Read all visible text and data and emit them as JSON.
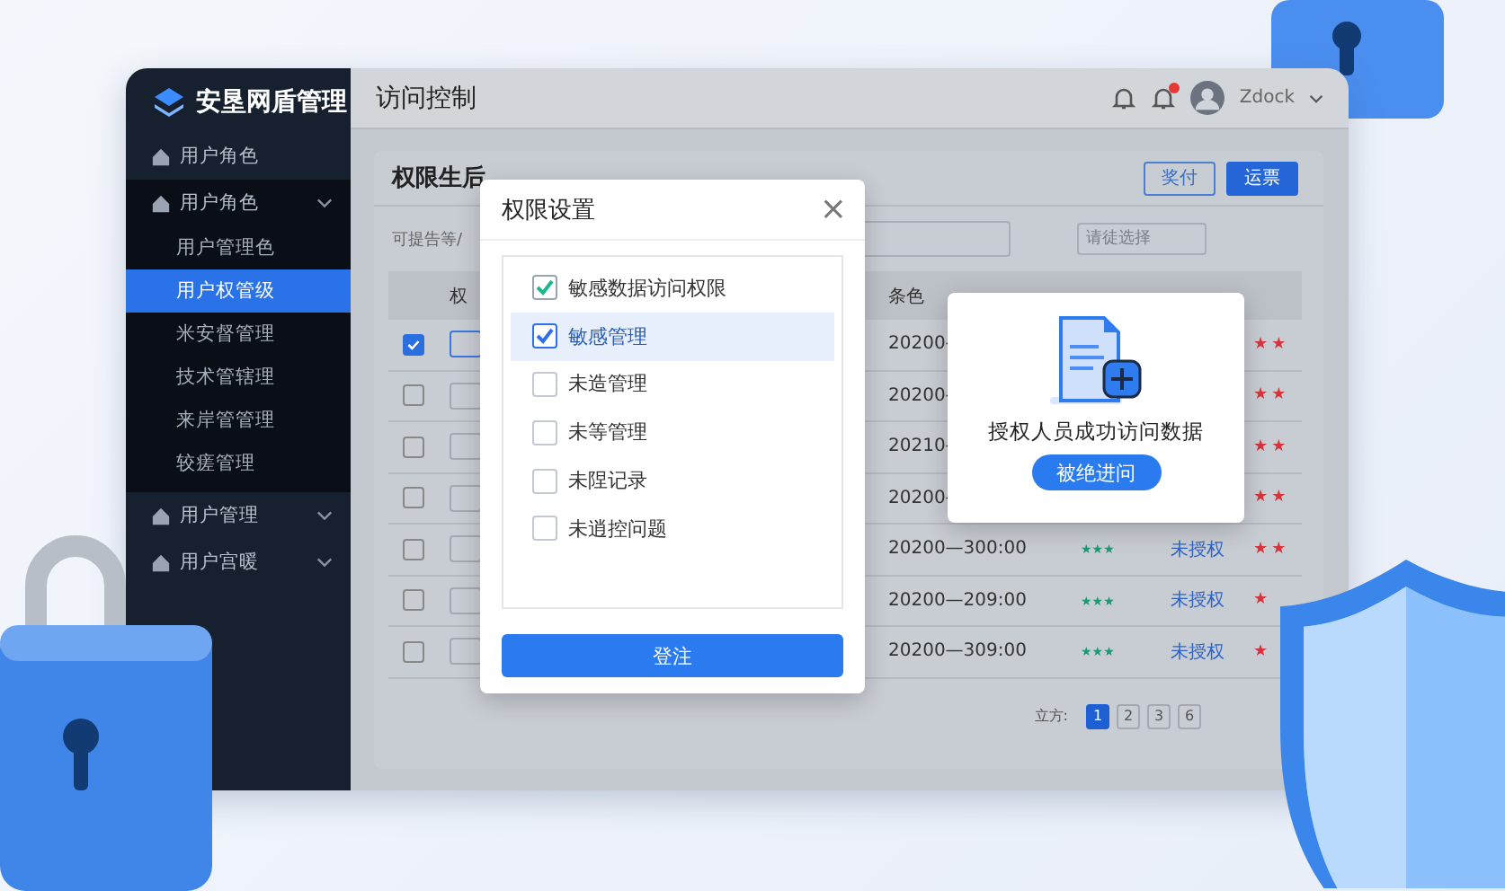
{
  "app": {
    "logo": "安垦网盾管理"
  },
  "sidebar": {
    "items": [
      {
        "label": "用户角色",
        "expanded": false,
        "has_chevron": false
      },
      {
        "label": "用户角色",
        "expanded": true,
        "has_chevron": true,
        "children": [
          {
            "label": "用户管理色",
            "selected": false
          },
          {
            "label": "用户权管级",
            "selected": true
          },
          {
            "label": "米安督管理",
            "selected": false
          },
          {
            "label": "技术管辖理",
            "selected": false
          },
          {
            "label": "来岸管管理",
            "selected": false
          },
          {
            "label": "较瘥管理",
            "selected": false
          }
        ]
      },
      {
        "label": "用户管理",
        "expanded": false,
        "has_chevron": true
      },
      {
        "label": "用户宫暖",
        "expanded": false,
        "has_chevron": true
      }
    ]
  },
  "header": {
    "title": "访问控制",
    "user": "Zdock",
    "notification_badge": true
  },
  "card": {
    "title": "权限生后",
    "buttons": [
      {
        "label": "奖付",
        "kind": "outline"
      },
      {
        "label": "运票",
        "kind": "primary"
      }
    ],
    "filter_label": "可提告等/",
    "filter_placeholder": "请徒选择",
    "columns": [
      "权",
      "条色"
    ],
    "rows": [
      {
        "checked": true,
        "time": "20200-",
        "priority": "★★"
      },
      {
        "checked": false,
        "time": "20200-",
        "priority": "★★"
      },
      {
        "checked": false,
        "time": "20210-",
        "priority": "★★"
      },
      {
        "checked": false,
        "time": "20200-",
        "priority": "★★"
      },
      {
        "checked": false,
        "time": "20200—300:00",
        "rating": {
          "stars": 3
        },
        "note": "未授权",
        "priority": "★★"
      },
      {
        "checked": false,
        "time": "20200—209:00",
        "rating": {
          "stars": 3
        },
        "note": "未授权",
        "priority": "★"
      },
      {
        "checked": false,
        "time": "20200—309:00",
        "rating": {
          "stars": 3
        },
        "note": "未授权",
        "priority": "★"
      }
    ],
    "pagination": {
      "label": "立方:",
      "pages": [
        {
          "label": "1",
          "selected": true
        },
        {
          "label": "2",
          "selected": false
        },
        {
          "label": "3",
          "selected": false
        },
        {
          "label": "6",
          "selected": false
        }
      ]
    }
  },
  "dialog": {
    "title": "权限设置",
    "close": "×",
    "options": [
      {
        "label": "敏感数据访问权限",
        "checked": true,
        "selected": false
      },
      {
        "label": "敏感管理",
        "checked": true,
        "selected": true
      },
      {
        "label": "未造管理",
        "checked": false,
        "selected": false
      },
      {
        "label": "未等管理",
        "checked": false,
        "selected": false
      },
      {
        "label": "未陧记录",
        "checked": false,
        "selected": false
      },
      {
        "label": "未逍控问题",
        "checked": false,
        "selected": false
      }
    ],
    "button": "登注"
  },
  "popup": {
    "message": "授权人员成功访问数据",
    "button": "被绝进问"
  }
}
